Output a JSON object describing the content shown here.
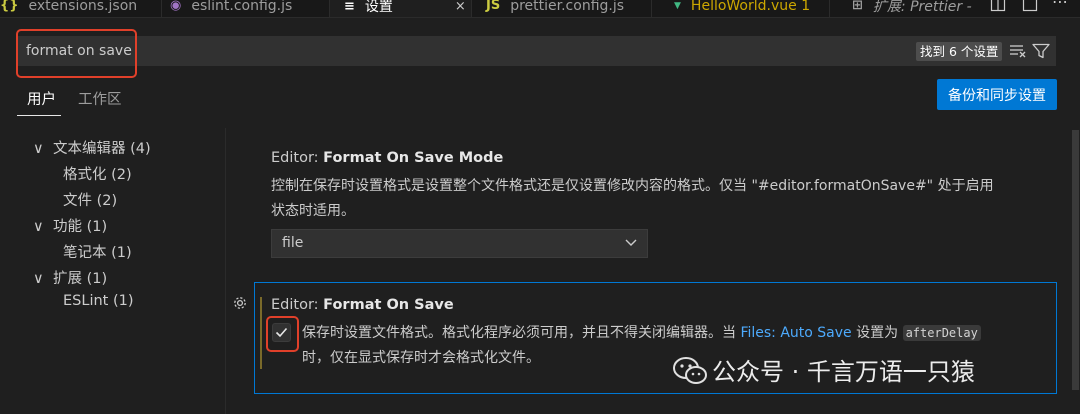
{
  "tabs": [
    {
      "label": "extensions.json",
      "icon": "{}",
      "icon_color": "#cbcb41",
      "close": "",
      "active": false,
      "italic": false
    },
    {
      "label": "eslint.config.js",
      "icon": "◉",
      "icon_color": "#a074c4",
      "close": "",
      "active": false,
      "italic": false
    },
    {
      "label": "设置",
      "icon": "≡",
      "icon_color": "#cccccc",
      "close": "×",
      "active": true,
      "italic": false
    },
    {
      "label": "prettier.config.js",
      "icon": "JS",
      "icon_color": "#cbcb41",
      "close": "",
      "active": false,
      "italic": false
    },
    {
      "label": "HelloWorld.vue 1",
      "icon": "▼",
      "icon_color": "#41b883",
      "close": "",
      "active": false,
      "italic": false,
      "label_color": "#cca700"
    },
    {
      "label": "扩展: Prettier -",
      "icon": "⊞",
      "icon_color": "#9d9d9d",
      "close": "",
      "active": false,
      "italic": true
    }
  ],
  "window_icons": [
    "split-editor-icon",
    "more-actions-icon"
  ],
  "search": {
    "value": "format on save",
    "result_count": "找到 6 个设置"
  },
  "scopes": {
    "user": "用户",
    "workspace": "工作区"
  },
  "sync_button": "备份和同步设置",
  "toc": [
    {
      "label": "文本编辑器 (4)",
      "chevron": "∨",
      "level": 0
    },
    {
      "label": "格式化 (2)",
      "chevron": "",
      "level": 1
    },
    {
      "label": "文件 (2)",
      "chevron": "",
      "level": 1
    },
    {
      "label": "功能 (1)",
      "chevron": "∨",
      "level": 0
    },
    {
      "label": "笔记本 (1)",
      "chevron": "",
      "level": 1
    },
    {
      "label": "扩展 (1)",
      "chevron": "∨",
      "level": 0
    },
    {
      "label": "ESLint (1)",
      "chevron": "",
      "level": 1
    }
  ],
  "settings": {
    "mode": {
      "category": "Editor: ",
      "name": "Format On Save Mode",
      "desc_line1": "控制在保存时设置格式是设置整个文件格式还是仅设置修改内容的格式。仅当 \"#editor.formatOnSave#\" 处于启用",
      "desc_line2": "状态时适用。",
      "value": "file"
    },
    "format_on_save": {
      "category": "Editor: ",
      "name": "Format On Save",
      "checked": true,
      "desc_part1": "保存时设置文件格式。格式化程序必须可用，并且不得关闭编辑器。当 ",
      "link": "Files: Auto Save",
      "desc_part2": " 设置为 ",
      "code": "afterDelay",
      "desc_line2": "时，仅在显式保存时才会格式化文件。"
    }
  },
  "watermark": "公众号 · 千言万语一只猿",
  "colors": {
    "accent": "#0078d4",
    "highlight": "#e0402a",
    "link": "#4daafc"
  }
}
